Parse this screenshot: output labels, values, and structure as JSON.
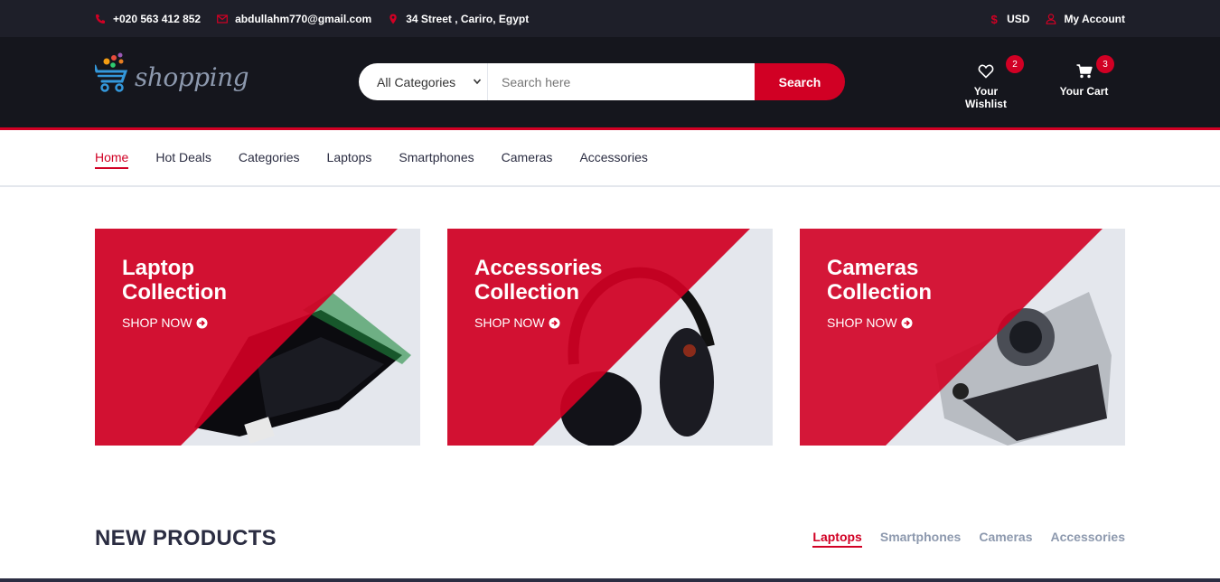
{
  "topbar": {
    "phone": "+020 563 412 852",
    "email": "abdullahm770@gmail.com",
    "address": "34 Street , Cariro, Egypt",
    "currency": "USD",
    "account": "My Account"
  },
  "logo": {
    "text": "shopping"
  },
  "search": {
    "category": "All Categories",
    "placeholder": "Search here",
    "button": "Search"
  },
  "header": {
    "wishlist_label": "Your Wishlist",
    "wishlist_count": "2",
    "cart_label": "Your Cart",
    "cart_count": "3"
  },
  "nav": [
    "Home",
    "Hot Deals",
    "Categories",
    "Laptops",
    "Smartphones",
    "Cameras",
    "Accessories"
  ],
  "collections": [
    {
      "line1": "Laptop",
      "line2": "Collection",
      "cta": "SHOP NOW"
    },
    {
      "line1": "Accessories",
      "line2": "Collection",
      "cta": "SHOP NOW"
    },
    {
      "line1": "Cameras",
      "line2": "Collection",
      "cta": "SHOP NOW"
    }
  ],
  "section": {
    "title": "NEW PRODUCTS",
    "tabs": [
      "Laptops",
      "Smartphones",
      "Cameras",
      "Accessories"
    ]
  },
  "colors": {
    "accent": "#d10024",
    "dark": "#15161d",
    "topbar": "#1e1f29"
  }
}
